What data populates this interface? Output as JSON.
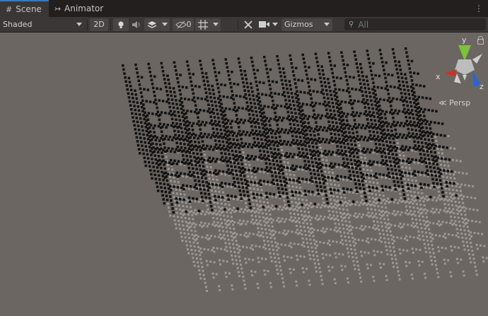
{
  "tabs": [
    {
      "label": "Scene",
      "icon": "grid-icon",
      "active": true
    },
    {
      "label": "Animator",
      "icon": "animator-icon",
      "active": false
    }
  ],
  "toolbar": {
    "shading_mode": "Shaded",
    "mode_2d": "2D",
    "hidden_count": "0",
    "gizmos_label": "Gizmos",
    "search_placeholder": "All"
  },
  "gizmo": {
    "axis_x": "x",
    "axis_y": "y",
    "axis_z": "z",
    "projection": "Persp"
  },
  "colors": {
    "x_axis": "#c8332a",
    "y_axis": "#7cc23a",
    "z_axis": "#2a63d6",
    "background": "#6b6662"
  }
}
